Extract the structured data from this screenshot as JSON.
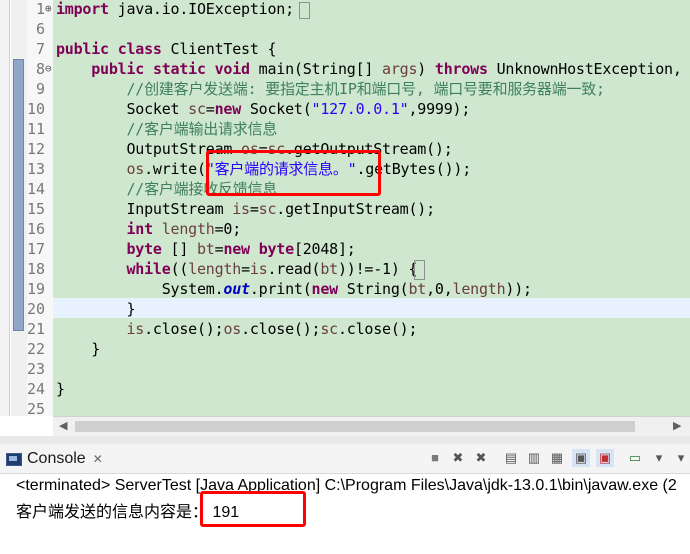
{
  "editor": {
    "lines": [
      {
        "num": "1",
        "fold": "+",
        "tokens": [
          {
            "c": "kw",
            "t": "import"
          },
          {
            "c": "",
            "t": " java.io.IOException;"
          }
        ]
      },
      {
        "num": "6",
        "fold": "",
        "tokens": []
      },
      {
        "num": "7",
        "fold": "",
        "tokens": [
          {
            "c": "kw",
            "t": "public"
          },
          {
            "c": "",
            "t": " "
          },
          {
            "c": "kw",
            "t": "class"
          },
          {
            "c": "",
            "t": " ClientTest {"
          }
        ]
      },
      {
        "num": "8",
        "fold": "-",
        "tokens": [
          {
            "c": "",
            "t": "    "
          },
          {
            "c": "kw",
            "t": "public"
          },
          {
            "c": "",
            "t": " "
          },
          {
            "c": "kw",
            "t": "static"
          },
          {
            "c": "",
            "t": " "
          },
          {
            "c": "kw",
            "t": "void"
          },
          {
            "c": "",
            "t": " main(String[] "
          },
          {
            "c": "var",
            "t": "args"
          },
          {
            "c": "",
            "t": ") "
          },
          {
            "c": "kw",
            "t": "throws"
          },
          {
            "c": "",
            "t": " UnknownHostException,"
          }
        ]
      },
      {
        "num": "9",
        "fold": "",
        "tokens": [
          {
            "c": "",
            "t": "        "
          },
          {
            "c": "cm",
            "t": "//创建客户发送端: 要指定主机IP和端口号, 端口号要和服务器端一致;"
          }
        ]
      },
      {
        "num": "10",
        "fold": "",
        "tokens": [
          {
            "c": "",
            "t": "        Socket "
          },
          {
            "c": "var",
            "t": "sc"
          },
          {
            "c": "",
            "t": "="
          },
          {
            "c": "kw",
            "t": "new"
          },
          {
            "c": "",
            "t": " Socket("
          },
          {
            "c": "str",
            "t": "\"127.0.0.1\""
          },
          {
            "c": "",
            "t": ",9999);"
          }
        ]
      },
      {
        "num": "11",
        "fold": "",
        "tokens": [
          {
            "c": "",
            "t": "        "
          },
          {
            "c": "cm",
            "t": "//客户端输出请求信息"
          }
        ]
      },
      {
        "num": "12",
        "fold": "",
        "tokens": [
          {
            "c": "",
            "t": "        OutputStream "
          },
          {
            "c": "var",
            "t": "os"
          },
          {
            "c": "",
            "t": "="
          },
          {
            "c": "var",
            "t": "sc"
          },
          {
            "c": "",
            "t": ".getOutputStream();"
          }
        ]
      },
      {
        "num": "13",
        "fold": "",
        "tokens": [
          {
            "c": "",
            "t": "        "
          },
          {
            "c": "var",
            "t": "os"
          },
          {
            "c": "",
            "t": ".write("
          },
          {
            "c": "str",
            "t": "\"客户端的请求信息。\""
          },
          {
            "c": "",
            "t": ".getBytes());"
          }
        ]
      },
      {
        "num": "14",
        "fold": "",
        "tokens": [
          {
            "c": "",
            "t": "        "
          },
          {
            "c": "cm",
            "t": "//客户端接收反馈信息"
          }
        ]
      },
      {
        "num": "15",
        "fold": "",
        "tokens": [
          {
            "c": "",
            "t": "        InputStream "
          },
          {
            "c": "var",
            "t": "is"
          },
          {
            "c": "",
            "t": "="
          },
          {
            "c": "var",
            "t": "sc"
          },
          {
            "c": "",
            "t": ".getInputStream();"
          }
        ]
      },
      {
        "num": "16",
        "fold": "",
        "tokens": [
          {
            "c": "",
            "t": "        "
          },
          {
            "c": "kw",
            "t": "int"
          },
          {
            "c": "",
            "t": " "
          },
          {
            "c": "var",
            "t": "length"
          },
          {
            "c": "",
            "t": "=0;"
          }
        ]
      },
      {
        "num": "17",
        "fold": "",
        "tokens": [
          {
            "c": "",
            "t": "        "
          },
          {
            "c": "kw",
            "t": "byte"
          },
          {
            "c": "",
            "t": " [] "
          },
          {
            "c": "var",
            "t": "bt"
          },
          {
            "c": "",
            "t": "="
          },
          {
            "c": "kw",
            "t": "new"
          },
          {
            "c": "",
            "t": " "
          },
          {
            "c": "kw",
            "t": "byte"
          },
          {
            "c": "",
            "t": "[2048];"
          }
        ]
      },
      {
        "num": "18",
        "fold": "",
        "tokens": [
          {
            "c": "",
            "t": "        "
          },
          {
            "c": "kw",
            "t": "while"
          },
          {
            "c": "",
            "t": "(("
          },
          {
            "c": "var",
            "t": "length"
          },
          {
            "c": "",
            "t": "="
          },
          {
            "c": "var",
            "t": "is"
          },
          {
            "c": "",
            "t": ".read("
          },
          {
            "c": "var",
            "t": "bt"
          },
          {
            "c": "",
            "t": "))!=-1) {"
          }
        ]
      },
      {
        "num": "19",
        "fold": "",
        "tokens": [
          {
            "c": "",
            "t": "            System."
          },
          {
            "c": "fld",
            "t": "out"
          },
          {
            "c": "",
            "t": ".print("
          },
          {
            "c": "kw",
            "t": "new"
          },
          {
            "c": "",
            "t": " String("
          },
          {
            "c": "var",
            "t": "bt"
          },
          {
            "c": "",
            "t": ",0,"
          },
          {
            "c": "var",
            "t": "length"
          },
          {
            "c": "",
            "t": "));"
          }
        ]
      },
      {
        "num": "20",
        "fold": "",
        "tokens": [
          {
            "c": "",
            "t": "        }"
          }
        ]
      },
      {
        "num": "21",
        "fold": "",
        "tokens": [
          {
            "c": "",
            "t": "        "
          },
          {
            "c": "var",
            "t": "is"
          },
          {
            "c": "",
            "t": ".close();"
          },
          {
            "c": "var",
            "t": "os"
          },
          {
            "c": "",
            "t": ".close();"
          },
          {
            "c": "var",
            "t": "sc"
          },
          {
            "c": "",
            "t": ".close();"
          }
        ]
      },
      {
        "num": "22",
        "fold": "",
        "tokens": [
          {
            "c": "",
            "t": "    }"
          }
        ]
      },
      {
        "num": "23",
        "fold": "",
        "tokens": []
      },
      {
        "num": "24",
        "fold": "",
        "tokens": [
          {
            "c": "",
            "t": "}"
          }
        ]
      },
      {
        "num": "25",
        "fold": "",
        "tokens": []
      }
    ]
  },
  "console": {
    "tab_label": "Console",
    "status": "<terminated> ServerTest [Java Application] C:\\Program Files\\Java\\jdk-13.0.1\\bin\\javaw.exe (2",
    "output_prefix": "客户端发送的信息内容是：",
    "output_value": "191"
  },
  "colors": {
    "code_background": "#cfe7cf",
    "current_line": "#e8f2fe",
    "keyword": "#7f0055",
    "string": "#2a00ff",
    "comment": "#3f7f5f",
    "highlight_box": "#ff0000"
  },
  "icons": [
    "fold-expand-icon",
    "fold-collapse-icon",
    "console-icon",
    "close-icon",
    "terminate-icon",
    "remove-launch-icon",
    "remove-all-icon",
    "scroll-lock-icon",
    "word-wrap-icon",
    "show-stdout-icon",
    "show-stderr-icon",
    "pin-console-icon",
    "display-console-icon",
    "new-console-icon",
    "minimize-icon"
  ]
}
